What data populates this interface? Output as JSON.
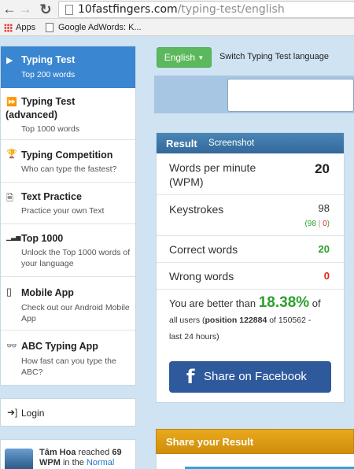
{
  "browser": {
    "url_domain": "10fastfingers.com",
    "url_path": "/typing-test/english",
    "bookmarks": [
      {
        "label": "Apps"
      },
      {
        "label": "Google AdWords: K..."
      }
    ]
  },
  "sidebar": {
    "items": [
      {
        "icon": "play-icon",
        "glyph": "▶",
        "title": "Typing Test",
        "sub": "Top 200 words"
      },
      {
        "icon": "fast-forward-icon",
        "glyph": "⏩",
        "title": "Typing Test (advanced)",
        "sub": "Top 1000 words"
      },
      {
        "icon": "trophy-icon",
        "glyph": "🏆",
        "title": "Typing Competition",
        "sub": "Who can type the fastest?"
      },
      {
        "icon": "document-icon",
        "glyph": "🗎",
        "title": "Text Practice",
        "sub": "Practice your own Text"
      },
      {
        "icon": "signal-bars-icon",
        "glyph": "▁▃▅",
        "title": "Top 1000",
        "sub": "Unlock the Top 1000 words of your language"
      },
      {
        "icon": "mobile-icon",
        "glyph": "▯",
        "title": "Mobile App",
        "sub": "Check out our Android Mobile App"
      },
      {
        "icon": "glasses-icon",
        "glyph": "👓",
        "title": "ABC Typing App",
        "sub": "How fast can you type the ABC?"
      }
    ],
    "login": {
      "icon": "login-icon",
      "label": "Login"
    },
    "activity": {
      "user": "Tâm Hoa",
      "text_mid": " reached ",
      "wpm": "69",
      "wpm_unit": "WPM",
      "text_tail": " in the ",
      "link": "Normal"
    }
  },
  "controls": {
    "language": "English",
    "switch_label": "Switch Typing Test language"
  },
  "result": {
    "title": "Result",
    "screenshot_link": "Screenshot",
    "wpm_label": "Words per minute (WPM)",
    "wpm_value": "20",
    "keystrokes_label": "Keystrokes",
    "keystrokes_value": "98",
    "keystrokes_correct": "98",
    "keystrokes_separator": "|",
    "keystrokes_wrong": "0",
    "correct_label": "Correct words",
    "correct_value": "20",
    "wrong_label": "Wrong words",
    "wrong_value": "0",
    "better_prefix": "You are better than ",
    "better_pct": "18.38%",
    "better_suffix": " of",
    "better_all_users": "all users (",
    "position_label": "position 122884",
    "position_of": " of 150562 -",
    "position_period": "last 24 hours)",
    "share_facebook": "Share on Facebook"
  },
  "share": {
    "title": "Share your Result"
  },
  "colors": {
    "accent_blue": "#3a86d0",
    "green": "#2ca12c",
    "red": "#e1261c",
    "facebook": "#2e5a9c",
    "share_orange": "#e9a91d"
  }
}
